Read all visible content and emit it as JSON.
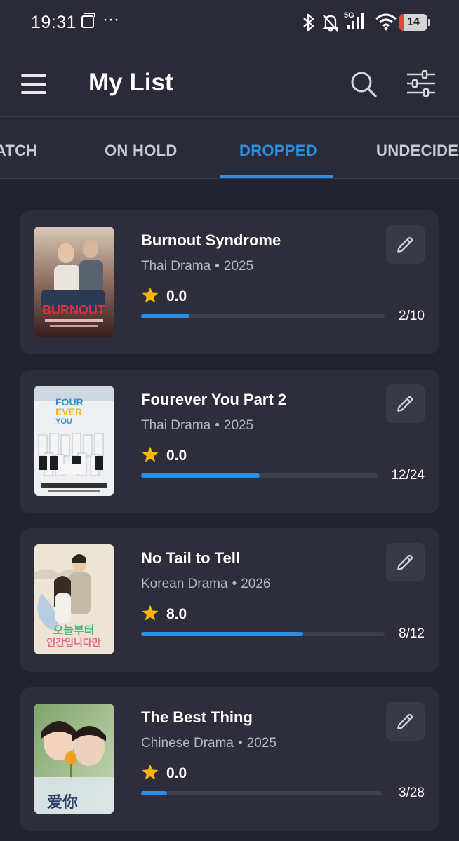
{
  "status_bar": {
    "time": "19:31",
    "network": "5G",
    "battery": "14",
    "battery_level": 0.14,
    "icons": [
      "screen-icon",
      "more-dots-icon",
      "bluetooth-icon",
      "mute-icon",
      "signal-icon",
      "wifi-icon",
      "battery-icon"
    ]
  },
  "appbar": {
    "title": "My List",
    "icons": [
      "menu-icon",
      "search-icon",
      "filter-icon"
    ]
  },
  "tabs": [
    {
      "label": "WATCH",
      "active": false
    },
    {
      "label": "ON HOLD",
      "active": false
    },
    {
      "label": "DROPPED",
      "active": true
    },
    {
      "label": "UNDECIDED",
      "active": false
    }
  ],
  "items": [
    {
      "title": "Burnout Syndrome",
      "category": "Thai Drama",
      "year": "2025",
      "rating": "0.0",
      "progress": "2/10",
      "watched": 2,
      "total": 10
    },
    {
      "title": "Fourever You Part 2",
      "category": "Thai Drama",
      "year": "2025",
      "rating": "0.0",
      "progress": "12/24",
      "watched": 12,
      "total": 24
    },
    {
      "title": "No Tail to Tell",
      "category": "Korean Drama",
      "year": "2026",
      "rating": "8.0",
      "progress": "8/12",
      "watched": 8,
      "total": 12
    },
    {
      "title": "The Best Thing",
      "category": "Chinese Drama",
      "year": "2025",
      "rating": "0.0",
      "progress": "3/28",
      "watched": 3,
      "total": 28
    }
  ],
  "colors": {
    "accent": "#2d8fe3",
    "background": "#222230",
    "card": "#2d2d3b",
    "star": "#f5b50a"
  }
}
